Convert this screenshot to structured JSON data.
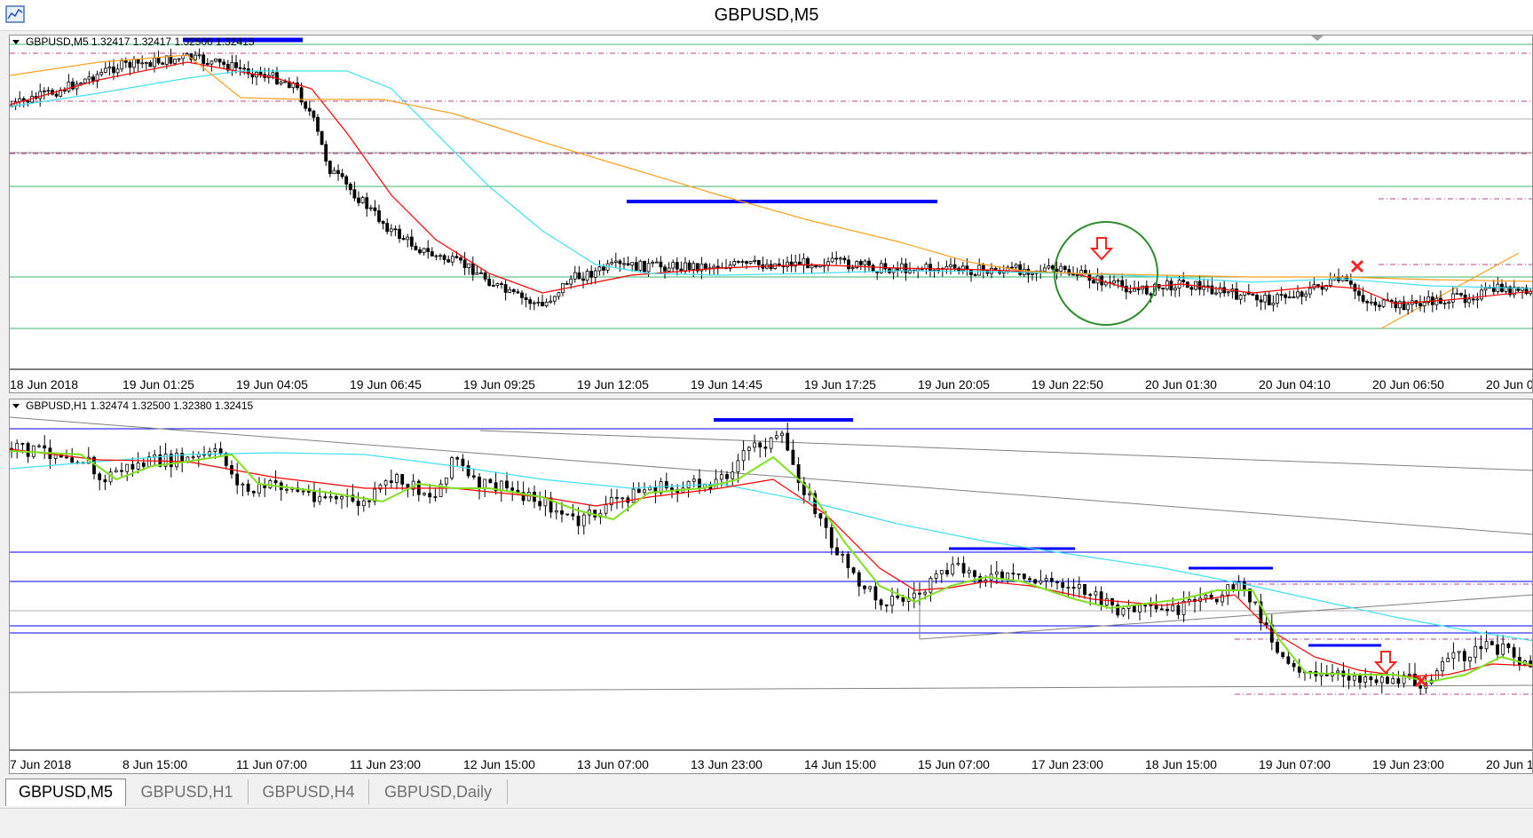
{
  "window": {
    "title": "GBPUSD,M5"
  },
  "pane_top": {
    "header": "GBPUSD,M5  1.32417 1.32417 1.32500 1.32415",
    "time_labels": [
      "18 Jun 2018",
      "19 Jun 01:25",
      "19 Jun 04:05",
      "19 Jun 06:45",
      "19 Jun 09:25",
      "19 Jun 12:05",
      "19 Jun 14:45",
      "19 Jun 17:25",
      "19 Jun 20:05",
      "19 Jun 22:50",
      "20 Jun 01:30",
      "20 Jun 04:10",
      "20 Jun 06:50",
      "20 Jun 0"
    ]
  },
  "pane_bottom": {
    "header": "GBPUSD,H1  1.32474 1.32500 1.32380 1.32415",
    "time_labels": [
      "7 Jun 2018",
      "8 Jun 15:00",
      "11 Jun 07:00",
      "11 Jun 23:00",
      "12 Jun 15:00",
      "13 Jun 07:00",
      "13 Jun 23:00",
      "14 Jun 15:00",
      "15 Jun 07:00",
      "17 Jun 23:00",
      "18 Jun 15:00",
      "19 Jun 07:00",
      "19 Jun 23:00",
      "20 Jun 1"
    ]
  },
  "tabs": [
    "GBPUSD,M5",
    "GBPUSD,H1",
    "GBPUSD,H4",
    "GBPUSD,Daily"
  ],
  "colors": {
    "candle": "#000000",
    "ma_red": "#ff0000",
    "ma_cyan": "#40e0f0",
    "ma_orange": "#ffa020",
    "ma_green": "#80e020",
    "level_blue": "#0000ff",
    "level_green": "#3cb371",
    "dash_magenta": "#c04090",
    "circle": "#2e8b2e",
    "arrow": "#ff2020"
  },
  "icons": [
    "chart-window-icon",
    "dropdown-triangle-icon",
    "down-arrow-icon",
    "x-mark-icon"
  ]
}
